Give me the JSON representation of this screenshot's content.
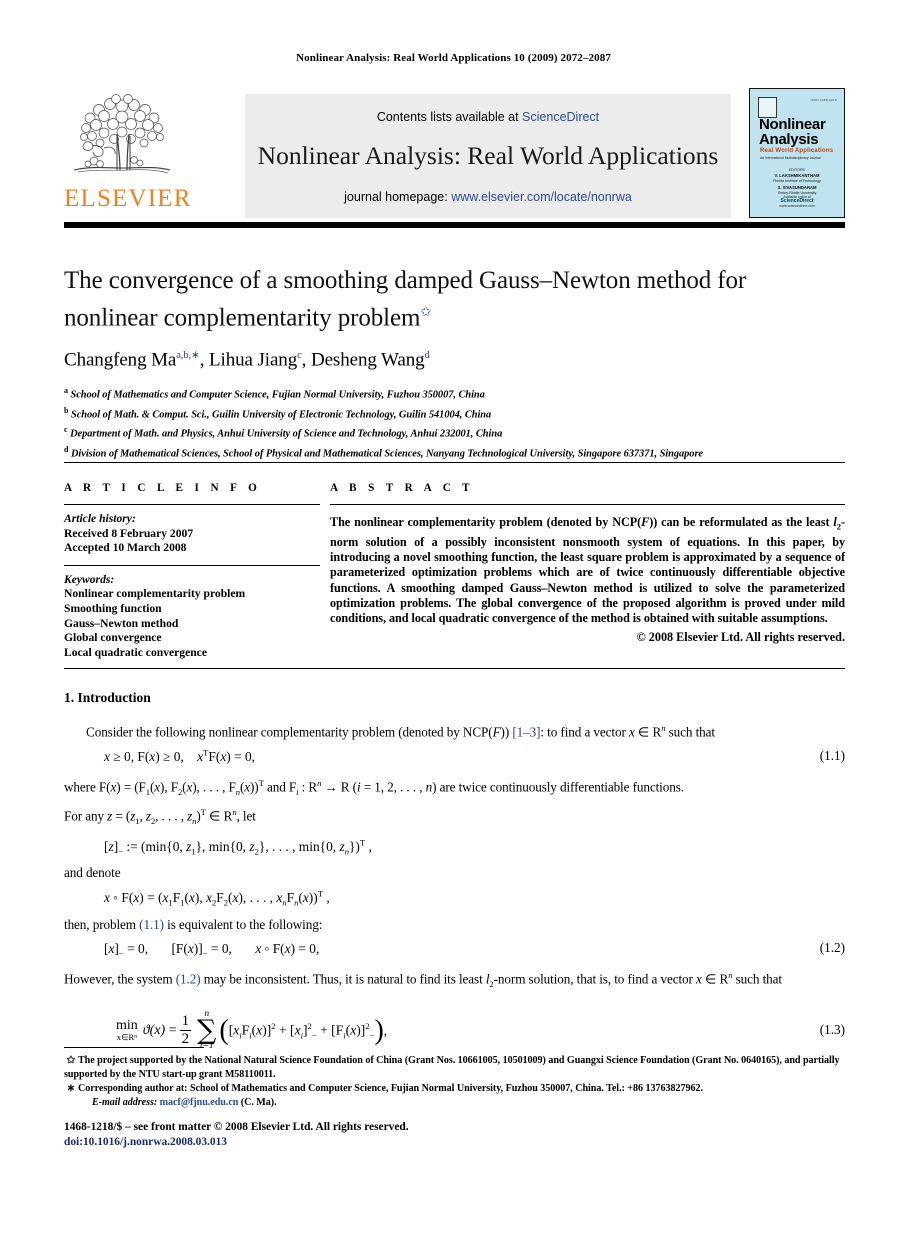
{
  "running_head": "Nonlinear Analysis: Real World Applications 10 (2009) 2072–2087",
  "masthead": {
    "publisher_name": "ELSEVIER",
    "contents_prefix": "Contents lists available at ",
    "contents_link": "ScienceDirect",
    "journal_title": "Nonlinear Analysis: Real World Applications",
    "homepage_prefix": "journal homepage: ",
    "homepage_link": "www.elsevier.com/locate/nonrwa"
  },
  "cover": {
    "issn": "ISSN 1468-1218",
    "title_line1": "Nonlinear",
    "title_line2": "Analysis",
    "subtitle": "Real World Applications",
    "blurb": "An International Multidisciplinary Journal",
    "editors_label": "EDITORS",
    "editor1": "V. LAKSHMIKANTHAM",
    "editor1_aff": "Florida Institute of Technology",
    "editor2": "S. SIVASUNDARAM",
    "editor2_aff": "Embry-Riddle University",
    "available_at": "Available online at",
    "platform": "ScienceDirect",
    "platform_url": "www.sciencedirect.com"
  },
  "article": {
    "title": "The convergence of a smoothing damped Gauss–Newton method for nonlinear complementarity problem",
    "title_marker": "✩",
    "authors": "Changfeng Ma",
    "author1_sup": "a,b,",
    "author1_star": "∗",
    "authors_rest": ", Lihua Jiang",
    "author2_sup": "c",
    "authors_rest2": ", Desheng Wang",
    "author3_sup": "d",
    "affiliations": [
      {
        "mark": "a",
        "text": "School of Mathematics and Computer Science, Fujian Normal University, Fuzhou 350007, China"
      },
      {
        "mark": "b",
        "text": "School of Math. & Comput. Sci., Guilin University of Electronic Technology, Guilin 541004, China"
      },
      {
        "mark": "c",
        "text": "Department of Math. and Physics, Anhui University of Science and Technology, Anhui 232001, China"
      },
      {
        "mark": "d",
        "text": "Division of Mathematical Sciences, School of Physical and Mathematical Sciences, Nanyang Technological University, Singapore 637371, Singapore"
      }
    ]
  },
  "info": {
    "heading": "A R T I C L E    I N F O",
    "history_label": "Article history:",
    "history": [
      "Received 8 February 2007",
      "Accepted 10 March 2008"
    ],
    "keywords_label": "Keywords:",
    "keywords": [
      "Nonlinear complementarity problem",
      "Smoothing function",
      "Gauss–Newton method",
      "Global convergence",
      "Local quadratic convergence"
    ]
  },
  "abstract": {
    "heading": "A B S T R A C T",
    "text": "The nonlinear complementarity problem (denoted by NCP(F)) can be reformulated as the least l2-norm solution of a possibly inconsistent nonsmooth system of equations. In this paper, by introducing a novel smoothing function, the least square problem is approximated by a sequence of parameterized optimization problems which are of twice continuously differentiable objective functions. A smoothing damped Gauss–Newton method is utilized to solve the parameterized optimization problems. The global convergence of the proposed algorithm is proved under mild conditions, and local quadratic convergence of the method is obtained with suitable assumptions.",
    "copyright": "© 2008 Elsevier Ltd. All rights reserved."
  },
  "body": {
    "section_heading": "1. Introduction",
    "para1_a": "Consider the following nonlinear complementarity problem (denoted by NCP(F)) ",
    "para1_ref": "[1–3]",
    "para1_b": ": to find a vector x ∈ R",
    "para1_sup": "n",
    "para1_c": " such that",
    "eq11_body": "x ≥ 0, F(x) ≥ 0,    x",
    "eq11_sup": "T",
    "eq11_tail": "F(x) = 0,",
    "eq11_no": "(1.1)",
    "para2_a": "where F(x) = (F",
    "para2": "where F(x) = (F1(x), F2(x), . . . , Fn(x))T and Fi : Rn → R (i = 1, 2, . . . , n) are twice continuously differentiable functions.",
    "para3": "For any z = (z1, z2, . . . , zn)T ∈ Rn, let",
    "eq_z": "[z]− := (min{0, z1}, min{0, z2}, . . . , min{0, zn})T ,",
    "para4": "and denote",
    "eq_xf": "x ◦ F(x) = (x1F1(x), x2F2(x), . . . , xnFn(x))T ,",
    "para5_a": "then, problem ",
    "para5_ref": "(1.1)",
    "para5_b": " is equivalent to the following:",
    "eq12": "[x]− = 0,        [F(x)]− = 0,        x ◦ F(x) = 0,",
    "eq12_no": "(1.2)",
    "para6_a": "However, the system ",
    "para6_ref": "(1.2)",
    "para6_b": " may be inconsistent. Thus, it is natural to find its least l2-norm solution, that is, to find a vector x ∈ Rn such that",
    "eq13_min": "min",
    "eq13_sub": "x∈Rⁿ",
    "eq13_lhs": "ϑ(x) =",
    "eq13_num": "1",
    "eq13_den": "2",
    "eq13_sum_top": "n",
    "eq13_sum_bot": "i=1",
    "eq13_rhs": "[xiFi(x)]² + [xi]²− + [Fi(x)]²−",
    "eq13_no": "(1.3)"
  },
  "footnotes": {
    "star_mark": "✩",
    "star_text": "The project supported by the National Natural Science Foundation of China (Grant Nos. 10661005, 10501009) and Guangxi Science Foundation (Grant No. 0640165), and partially supported by the NTU start-up grant M58110011.",
    "corr_mark": "∗",
    "corr_text": "Corresponding author at: School of Mathematics and Computer Science, Fujian Normal University, Fuzhou 350007, China. Tel.: +86 13763827962.",
    "email_label": "E-mail address:",
    "email": "macf@fjnu.edu.cn",
    "email_suffix": " (C. Ma)."
  },
  "imprint": {
    "line1": "1468-1218/$ – see front matter © 2008 Elsevier Ltd. All rights reserved.",
    "doi": "doi:10.1016/j.nonrwa.2008.03.013"
  },
  "colors": {
    "link": "#2b4b9b",
    "elsevier_orange": "#F0821E",
    "panel_grey": "#ececec",
    "cover_blue": "#bfe4ef",
    "doi_navy": "#1a2a6c"
  }
}
